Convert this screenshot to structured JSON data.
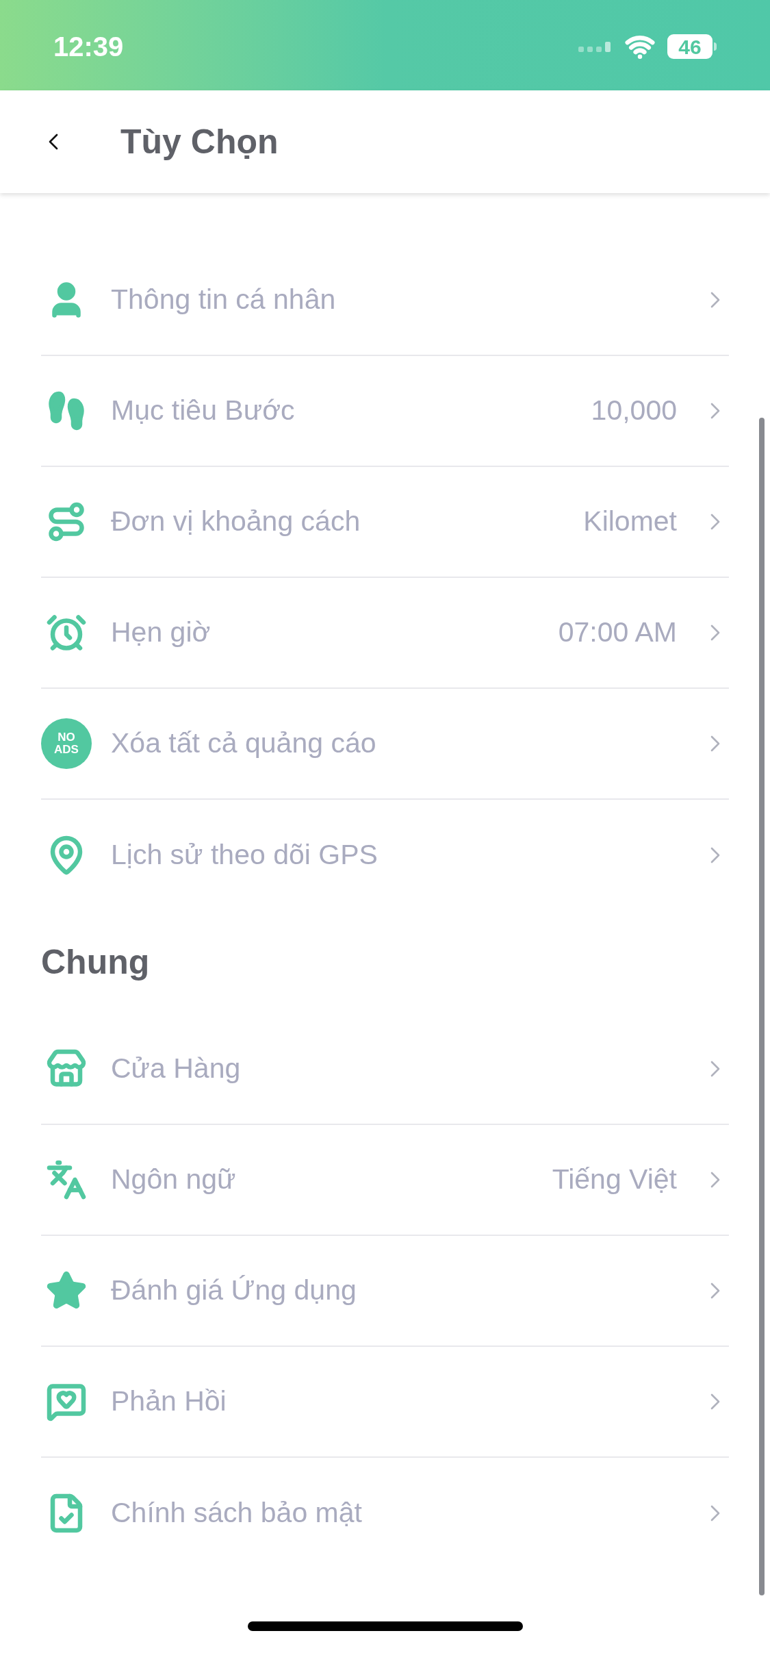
{
  "status_bar": {
    "time": "12:39",
    "battery": "46"
  },
  "header": {
    "title": "Tùy Chọn"
  },
  "sections": [
    {
      "items": [
        {
          "label": "Thông tin cá nhân"
        },
        {
          "label": "Mục tiêu Bước",
          "value": "10,000"
        },
        {
          "label": "Đơn vị khoảng cách",
          "value": "Kilomet"
        },
        {
          "label": "Hẹn giờ",
          "value": "07:00 AM"
        },
        {
          "label": "Xóa tất cả quảng cáo",
          "badge": [
            "NO",
            "ADS"
          ]
        },
        {
          "label": "Lịch sử theo dõi GPS"
        }
      ]
    },
    {
      "title": "Chung",
      "items": [
        {
          "label": "Cửa Hàng"
        },
        {
          "label": "Ngôn ngữ",
          "value": "Tiếng Việt"
        },
        {
          "label": "Đánh giá Ứng dụng"
        },
        {
          "label": "Phản Hồi"
        },
        {
          "label": "Chính sách bảo mật"
        }
      ]
    }
  ]
}
